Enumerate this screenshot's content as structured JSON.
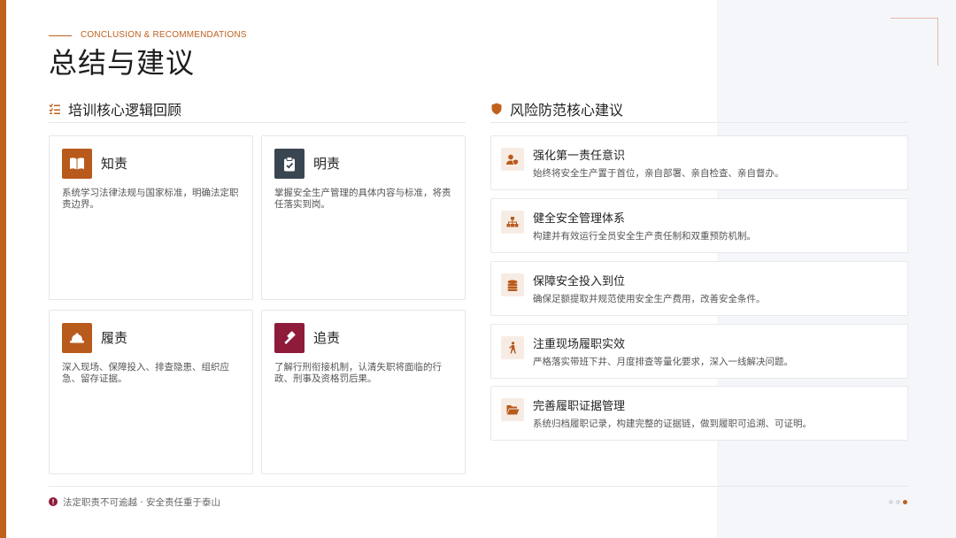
{
  "header": {
    "eyebrow": "CONCLUSION & RECOMMENDATIONS",
    "title": "总结与建议"
  },
  "left_section": {
    "title": "培训核心逻辑回顾",
    "icon": "list-check-icon",
    "cards": [
      {
        "title": "知责",
        "desc": "系统学习法律法规与国家标准，明确法定职责边界。",
        "icon": "book-icon",
        "color": "#b85a1c"
      },
      {
        "title": "明责",
        "desc": "掌握安全生产管理的具体内容与标准，将责任落实到岗。",
        "icon": "clipboard-check-icon",
        "color": "#3a4552"
      },
      {
        "title": "履责",
        "desc": "深入现场、保障投入、排查隐患、组织应急、留存证据。",
        "icon": "hard-hat-icon",
        "color": "#b85a1c"
      },
      {
        "title": "追责",
        "desc": "了解行刑衔接机制，认清失职将面临的行政、刑事及资格罚后果。",
        "icon": "gavel-icon",
        "color": "#8e1b3a"
      }
    ]
  },
  "right_section": {
    "title": "风险防范核心建议",
    "icon": "shield-icon",
    "items": [
      {
        "title": "强化第一责任意识",
        "desc": "始终将安全生产置于首位，亲自部署、亲自检查、亲自督办。",
        "icon": "user-shield-icon"
      },
      {
        "title": "健全安全管理体系",
        "desc": "构建并有效运行全员安全生产责任制和双重预防机制。",
        "icon": "sitemap-icon"
      },
      {
        "title": "保障安全投入到位",
        "desc": "确保足额提取并规范使用安全生产费用，改善安全条件。",
        "icon": "coins-icon"
      },
      {
        "title": "注重现场履职实效",
        "desc": "严格落实带班下井、月度排查等量化要求，深入一线解决问题。",
        "icon": "walking-person-icon"
      },
      {
        "title": "完善履职证据管理",
        "desc": "系统归档履职记录，构建完整的证据链，做到履职可追溯、可证明。",
        "icon": "folder-open-icon"
      }
    ]
  },
  "footer": {
    "text": "法定职责不可逾越 · 安全责任重于泰山",
    "icon": "exclamation-circle-icon"
  },
  "colors": {
    "accent": "#c0611e",
    "dark_slate": "#3a4552",
    "crimson": "#8e1b3a"
  }
}
